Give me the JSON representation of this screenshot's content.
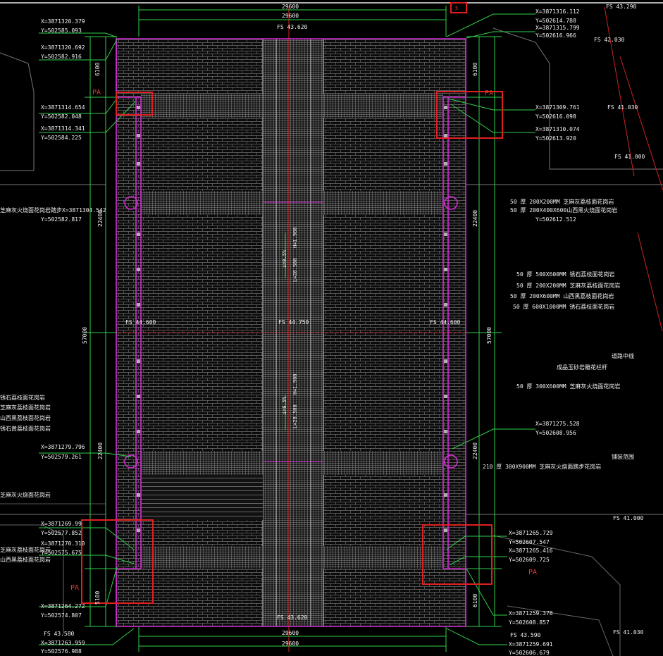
{
  "colors": {
    "background": "#000000",
    "coord_line": "#2fd14a",
    "paving_outline": "#d52cd5",
    "highlight_box": "#e02020",
    "text": "#f2f2f2",
    "centerline": "#e02020"
  },
  "top": {
    "dim_a": "29600",
    "dim_b": "29600",
    "elev": "FS 43.620",
    "elev_right_top": "FS 43.290",
    "elev_right_2": "FS 42.030",
    "red_small": "5"
  },
  "bottom": {
    "dim_a": "29600",
    "dim_b": "29600",
    "elev": "FS 43.620",
    "fs_left": "FS 43.580",
    "fs_right": "FS 43.590",
    "fs_far_right": "FS 41.030"
  },
  "side_dims": {
    "d6100_tl": "6100",
    "d22400_l1": "22400",
    "d57000_l": "57000",
    "d22400_l2": "22400",
    "d5100_bl": "5100",
    "d6100_tr": "6100",
    "d22400_r1": "22400",
    "d57000_r": "57000",
    "d22400_r2": "22400",
    "d6100_br": "6100"
  },
  "center": {
    "fs_mid_left": "FS 44.600",
    "fs_center": "FS 44.750",
    "fs_mid_right": "FS 44.600",
    "slope_up_pct": "i=0.5%",
    "slope_up_len": "L=28.500",
    "slope_up_v": "H=1.900",
    "slope_dn_pct": "i=0.5%",
    "slope_dn_len": "L=28.500",
    "slope_dn_v": "H=1.900"
  },
  "coords_left": [
    {
      "x": "X=3871320.379",
      "y": "Y=502585.093"
    },
    {
      "x": "X=3871320.692",
      "y": "Y=502582.916"
    },
    {
      "x": "X=3871314.654",
      "y": "Y=502582.048"
    },
    {
      "x": "X=3871314.341",
      "y": "Y=502584.225"
    },
    {
      "x": "芝麻灰火烧面花岗岩踏步X=3871304.542",
      "y": "Y=502582.817"
    },
    {
      "x": "X=3871279.796",
      "y": "Y=502579.261"
    },
    {
      "x": "X=3871269.99",
      "y": "Y=502577.852"
    },
    {
      "x": "X=3871270.310",
      "y": "Y=502575.675"
    },
    {
      "x": "X=3871264.272",
      "y": "Y=502574.807"
    },
    {
      "x": "X=3871263.959",
      "y": "Y=502576.988"
    }
  ],
  "coords_right": [
    {
      "x": "X=3871316.112",
      "y": "Y=502614.788"
    },
    {
      "x": "X=3871315.799",
      "y": "Y=502616.966"
    },
    {
      "x": "X=3871309.761",
      "y": "Y=502616.098"
    },
    {
      "x": "X=3871310.074",
      "y": "Y=502613.920"
    },
    {
      "x": "X=3871275.528",
      "y": "Y=502608.956"
    },
    {
      "x": "X=3871265.729",
      "y": "Y=502607.547"
    },
    {
      "x": "X=3871265.416",
      "y": "Y=502609.725"
    },
    {
      "x": "X=3871259.378",
      "y": "Y=502608.857"
    },
    {
      "x": "X=3871259.691",
      "y": "Y=502606.679"
    }
  ],
  "notes_right": {
    "n1": "50 厚 200X200MM  芝麻灰荔枝面花岗岩",
    "n2": "50 厚 200X400X600山西黑火烧面花岗岩",
    "n3": "50 厚 500X600MM  锈石荔枝面花岗岩",
    "n4": "50 厚 200X200MM  芝麻灰荔枝面花岗岩",
    "n5": "50 厚 200X600MM  山西黑荔枝面花岗岩",
    "n6": "50 厚 600X1000MM  锈石荔枝面花岗岩",
    "n7": "道路中线",
    "n8": "成品玉砂岩雕花栏杆",
    "n9": "50 厚 300X600MM  芝麻灰火烧面花岗岩",
    "n10": "210 厚  300X900MM  芝麻灰火烧面踏步花岗岩",
    "n11": "铺装范围",
    "fs_41030": "FS 41.030",
    "fs_41000": "FS 41.000",
    "fs_41000b": "FS 41.000"
  },
  "notes_left": {
    "n1": "锈石荔枝面花岗岩",
    "n2": "芝麻灰荔枝面花岗岩",
    "n3": "山西黑荔枝面花岗岩",
    "n4": "锈石黄荔枝面花岗岩",
    "n5": "芝麻灰火烧面花岗岩"
  },
  "markers": {
    "pa_tl": "PA",
    "pa_tr": "PA",
    "pa_bl": "PA",
    "pa_br": "PA"
  }
}
